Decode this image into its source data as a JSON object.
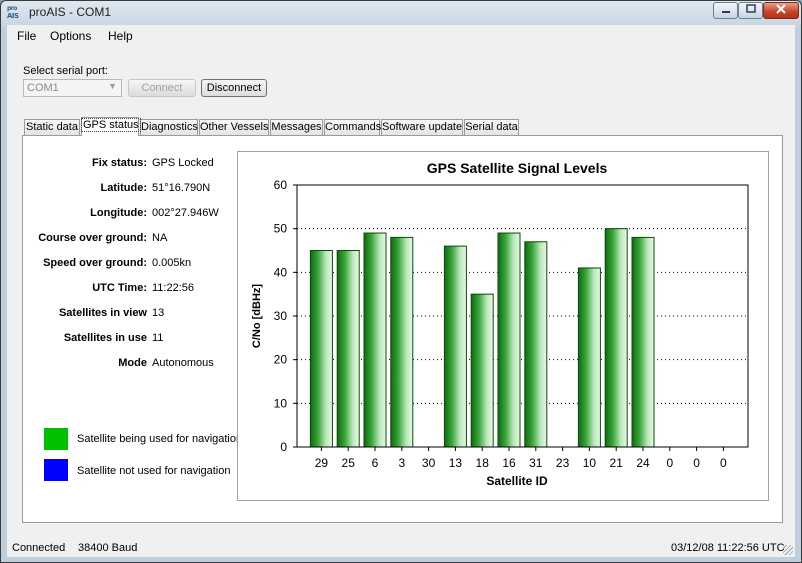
{
  "window": {
    "title": "proAIS - COM1",
    "icon_text": "AIS"
  },
  "menu": [
    "File",
    "Options",
    "Help"
  ],
  "serial": {
    "label": "Select serial port:",
    "port_value": "COM1",
    "connect_label": "Connect",
    "disconnect_label": "Disconnect"
  },
  "tabs": [
    "Static data",
    "GPS status",
    "Diagnostics",
    "Other Vessels",
    "Messages",
    "Commands",
    "Software update",
    "Serial data"
  ],
  "active_tab": "GPS status",
  "gps": {
    "fields": [
      {
        "label": "Fix status:",
        "value": "GPS Locked"
      },
      {
        "label": "Latitude:",
        "value": "51°16.790N"
      },
      {
        "label": "Longitude:",
        "value": "002°27.946W"
      },
      {
        "label": "Course over ground:",
        "value": "NA"
      },
      {
        "label": "Speed over ground:",
        "value": "0.005kn"
      },
      {
        "label": "UTC Time:",
        "value": "11:22:56"
      },
      {
        "label": "Satellites in view",
        "value": "13"
      },
      {
        "label": "Satellites in use",
        "value": "11"
      },
      {
        "label": "Mode",
        "value": "Autonomous"
      }
    ],
    "legend": [
      {
        "label": "Satellite being used for navigation",
        "color": "#00c000"
      },
      {
        "label": "Satellite not used for navigation",
        "color": "#0000ff"
      }
    ]
  },
  "chart_data": {
    "type": "bar",
    "title": "GPS Satellite Signal Levels",
    "xlabel": "Satellite ID",
    "ylabel": "C/No [dBHz]",
    "ylim": [
      0,
      60
    ],
    "yticks": [
      0,
      10,
      20,
      30,
      40,
      50,
      60
    ],
    "grid": true,
    "categories": [
      "29",
      "25",
      "6",
      "3",
      "30",
      "13",
      "18",
      "16",
      "31",
      "23",
      "10",
      "21",
      "24",
      "0",
      "0",
      "0"
    ],
    "values": [
      45,
      45,
      49,
      48,
      0,
      46,
      35,
      49,
      47,
      0,
      41,
      50,
      48,
      0,
      0,
      0
    ],
    "bar_color": "#1f8c1f"
  },
  "status": {
    "connection": "Connected",
    "baud": "38400 Baud",
    "datetime": "03/12/08  11:22:56 UTC"
  }
}
